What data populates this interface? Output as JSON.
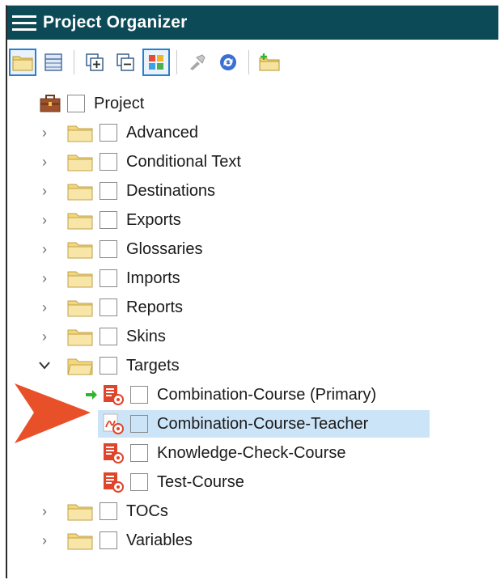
{
  "panel": {
    "title": "Project Organizer"
  },
  "toolbar": {
    "buttons": [
      {
        "icon": "folder-view-icon",
        "active": true
      },
      {
        "icon": "table-view-icon",
        "active": false
      },
      {
        "icon": "expand-all-icon",
        "active": false
      },
      {
        "icon": "collapse-all-icon",
        "active": false
      },
      {
        "icon": "color-grid-icon",
        "active": true
      },
      {
        "icon": "build-icon",
        "active": false
      },
      {
        "icon": "refresh-icon",
        "active": false
      },
      {
        "icon": "new-folder-icon",
        "active": false
      }
    ]
  },
  "tree": {
    "root": "Project",
    "items": [
      {
        "label": "Advanced",
        "expanded": false
      },
      {
        "label": "Conditional Text",
        "expanded": false
      },
      {
        "label": "Destinations",
        "expanded": false
      },
      {
        "label": "Exports",
        "expanded": false
      },
      {
        "label": "Glossaries",
        "expanded": false
      },
      {
        "label": "Imports",
        "expanded": false
      },
      {
        "label": "Reports",
        "expanded": false
      },
      {
        "label": "Skins",
        "expanded": false
      },
      {
        "label": "Targets",
        "expanded": true
      },
      {
        "label": "TOCs",
        "expanded": false
      },
      {
        "label": "Variables",
        "expanded": false
      }
    ],
    "targets": [
      {
        "label": "Combination-Course (Primary)",
        "primary": true,
        "selected": false,
        "icon": "html5-target-icon"
      },
      {
        "label": "Combination-Course-Teacher",
        "primary": false,
        "selected": true,
        "icon": "pdf-target-icon"
      },
      {
        "label": "Knowledge-Check-Course",
        "primary": false,
        "selected": false,
        "icon": "html5-target-icon"
      },
      {
        "label": "Test-Course",
        "primary": false,
        "selected": false,
        "icon": "html5-target-icon"
      }
    ]
  },
  "colors": {
    "titlebar": "#0b4a56",
    "selection": "#cce4f7",
    "callout_arrow": "#e8502a",
    "primary_arrow": "#2fb52f"
  }
}
